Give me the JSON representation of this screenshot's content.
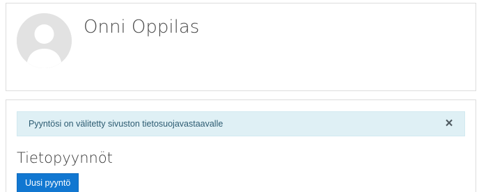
{
  "profile": {
    "name": "Onni Oppilas",
    "avatar_icon": "user-avatar-placeholder"
  },
  "alert": {
    "message": "Pyyntösi on välitetty sivuston tietosuojavastaavalle",
    "close_label": "×",
    "close_icon": "close-icon"
  },
  "section": {
    "title": "Tietopyynnöt"
  },
  "actions": {
    "new_request_label": "Uusi pyyntö"
  },
  "colors": {
    "primary": "#1177d1",
    "alert_background": "#dff0f5",
    "alert_text": "#2d5c72",
    "avatar_background": "#e2e2e2"
  }
}
